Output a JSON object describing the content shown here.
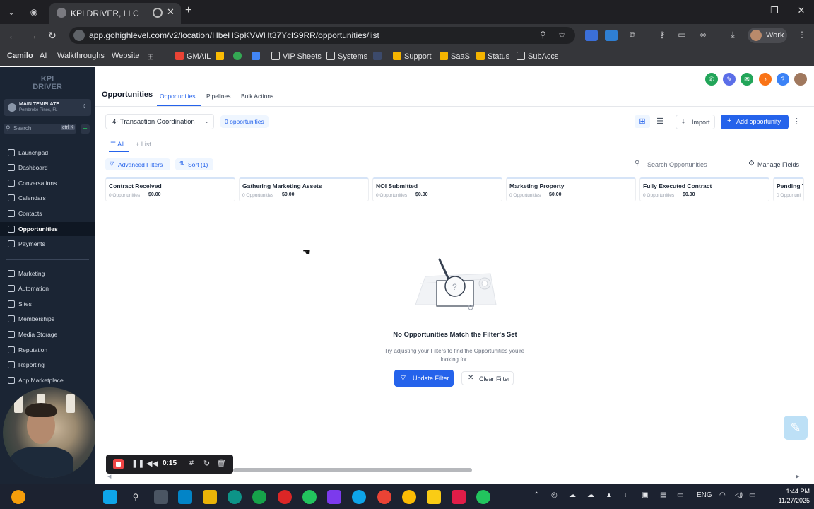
{
  "browser": {
    "tab_title": "KPI DRIVER, LLC",
    "url": "app.gohighlevel.com/v2/location/HbeHSpKVWHt37YclS9RR/opportunities/list",
    "profile": "Work",
    "bookmarks": [
      "Camilo",
      "AI",
      "Walkthroughs",
      "Website",
      "GMAIL",
      "VIP Sheets",
      "Systems",
      "Support",
      "SaaS",
      "Status",
      "SubAccs"
    ]
  },
  "sidebar": {
    "logo": "KPI DRIVER",
    "account_name": "MAIN TEMPLATE",
    "account_location": "Pembroke Pines, FL",
    "search_placeholder": "Search",
    "search_shortcut": "ctrl K",
    "items": [
      {
        "label": "Launchpad"
      },
      {
        "label": "Dashboard"
      },
      {
        "label": "Conversations"
      },
      {
        "label": "Calendars"
      },
      {
        "label": "Contacts"
      },
      {
        "label": "Opportunities",
        "active": true
      },
      {
        "label": "Payments"
      },
      {
        "label": "Marketing"
      },
      {
        "label": "Automation"
      },
      {
        "label": "Sites"
      },
      {
        "label": "Memberships"
      },
      {
        "label": "Media Storage"
      },
      {
        "label": "Reputation"
      },
      {
        "label": "Reporting"
      },
      {
        "label": "App Marketplace"
      }
    ]
  },
  "header": {
    "title": "Opportunities",
    "tabs": [
      "Opportunities",
      "Pipelines",
      "Bulk Actions"
    ]
  },
  "toolbar": {
    "pipeline": "4- Transaction Coordination",
    "count": "0 opportunities",
    "import_label": "Import",
    "add_label": "Add opportunity"
  },
  "filters": {
    "tabs": [
      "All",
      "List"
    ],
    "advanced": "Advanced Filters",
    "sort": "Sort (1)",
    "search_placeholder": "Search Opportunities",
    "manage_fields": "Manage Fields"
  },
  "stages": [
    {
      "name": "Contract Received",
      "count": "0 Opportunities",
      "value": "$0.00"
    },
    {
      "name": "Gathering Marketing Assets",
      "count": "0 Opportunities",
      "value": "$0.00"
    },
    {
      "name": "NOI Submitted",
      "count": "0 Opportunities",
      "value": "$0.00"
    },
    {
      "name": "Marketing Property",
      "count": "0 Opportunities",
      "value": "$0.00"
    },
    {
      "name": "Fully Executed Contract",
      "count": "0 Opportunities",
      "value": "$0.00"
    },
    {
      "name": "Pending T",
      "count": "0 Opportuni",
      "value": ""
    }
  ],
  "empty_state": {
    "title": "No Opportunities Match the Filter's Set",
    "subtitle": "Try adjusting your Filters to find the Opportunities you're looking for.",
    "update_label": "Update Filter",
    "clear_label": "Clear Filter"
  },
  "recorder": {
    "time": "0:15"
  },
  "taskbar": {
    "language": "ENG",
    "time": "1:44 PM",
    "date": "11/27/2025"
  },
  "colors": {
    "sidebar": "#1b2534",
    "accent": "#2563eb",
    "browser_chrome": "#35363a"
  }
}
